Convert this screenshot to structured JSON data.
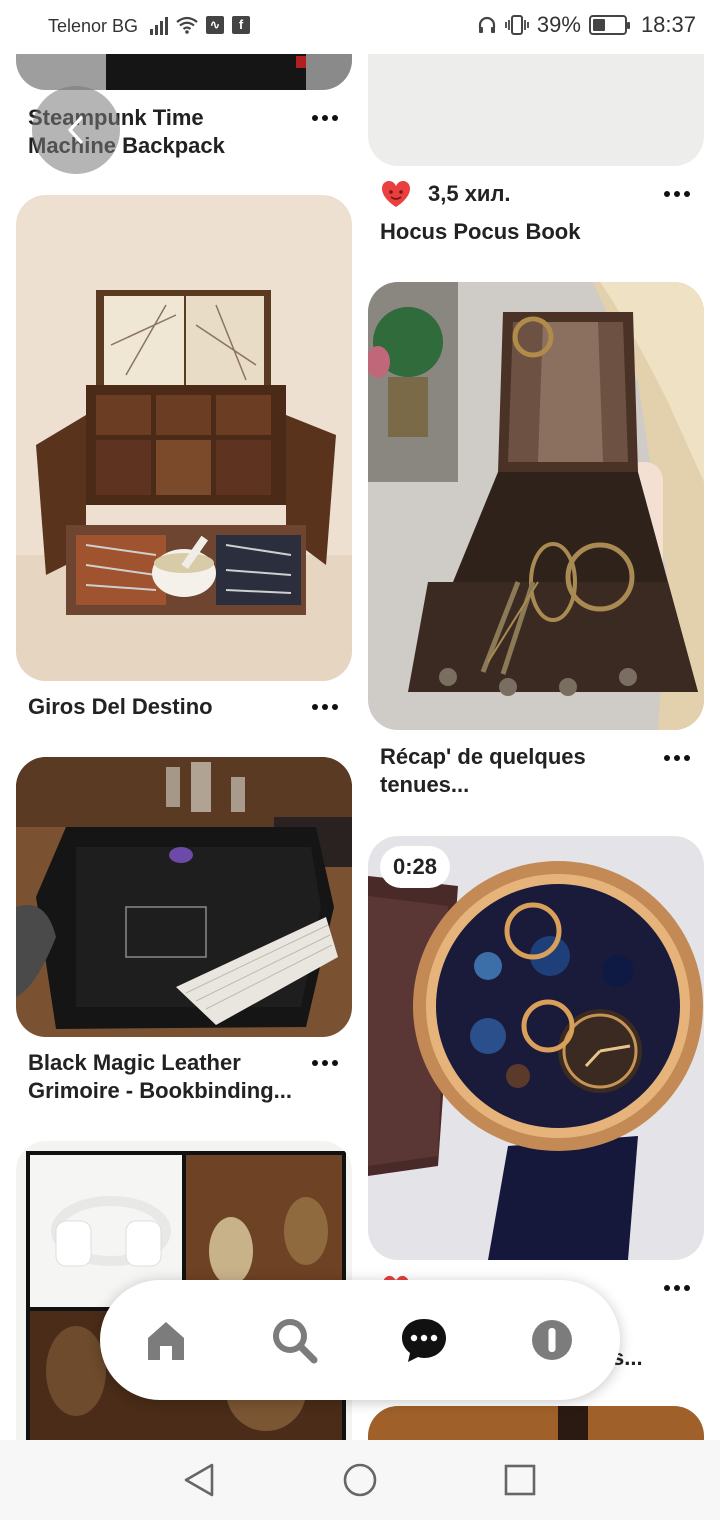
{
  "status_bar": {
    "carrier": "Telenor BG",
    "battery": "39%",
    "battery_level": 0.39,
    "time": "18:37",
    "icons": [
      "signal-icon",
      "wifi-icon",
      "activity-icon",
      "facebook-icon",
      "headphones-icon",
      "vibrate-icon",
      "battery-icon"
    ]
  },
  "pins": {
    "steampunk": {
      "title_line1": "Steampunk Time",
      "title_line2": "Machine Backpack"
    },
    "hocus": {
      "reactions": "3,5 хил.",
      "title": "Hocus Pocus Book"
    },
    "giros": {
      "title": "Giros Del Destino"
    },
    "recap": {
      "title_line1": "Récap' de quelques",
      "title_line2": "tenues..."
    },
    "grimoire": {
      "title_line1": "Black Magic Leather",
      "title_line2": "Grimoire - Bookbinding..."
    },
    "watch": {
      "duration": "0:28",
      "title_tail": "s..."
    }
  },
  "bottom_nav": {
    "items": [
      "home-icon",
      "search-icon",
      "messages-icon",
      "notifications-icon"
    ]
  },
  "system_nav": {
    "items": [
      "back-icon",
      "home-icon",
      "recents-icon"
    ]
  },
  "colors": {
    "accent_red": "#e60023",
    "heart": "#e8403f"
  }
}
